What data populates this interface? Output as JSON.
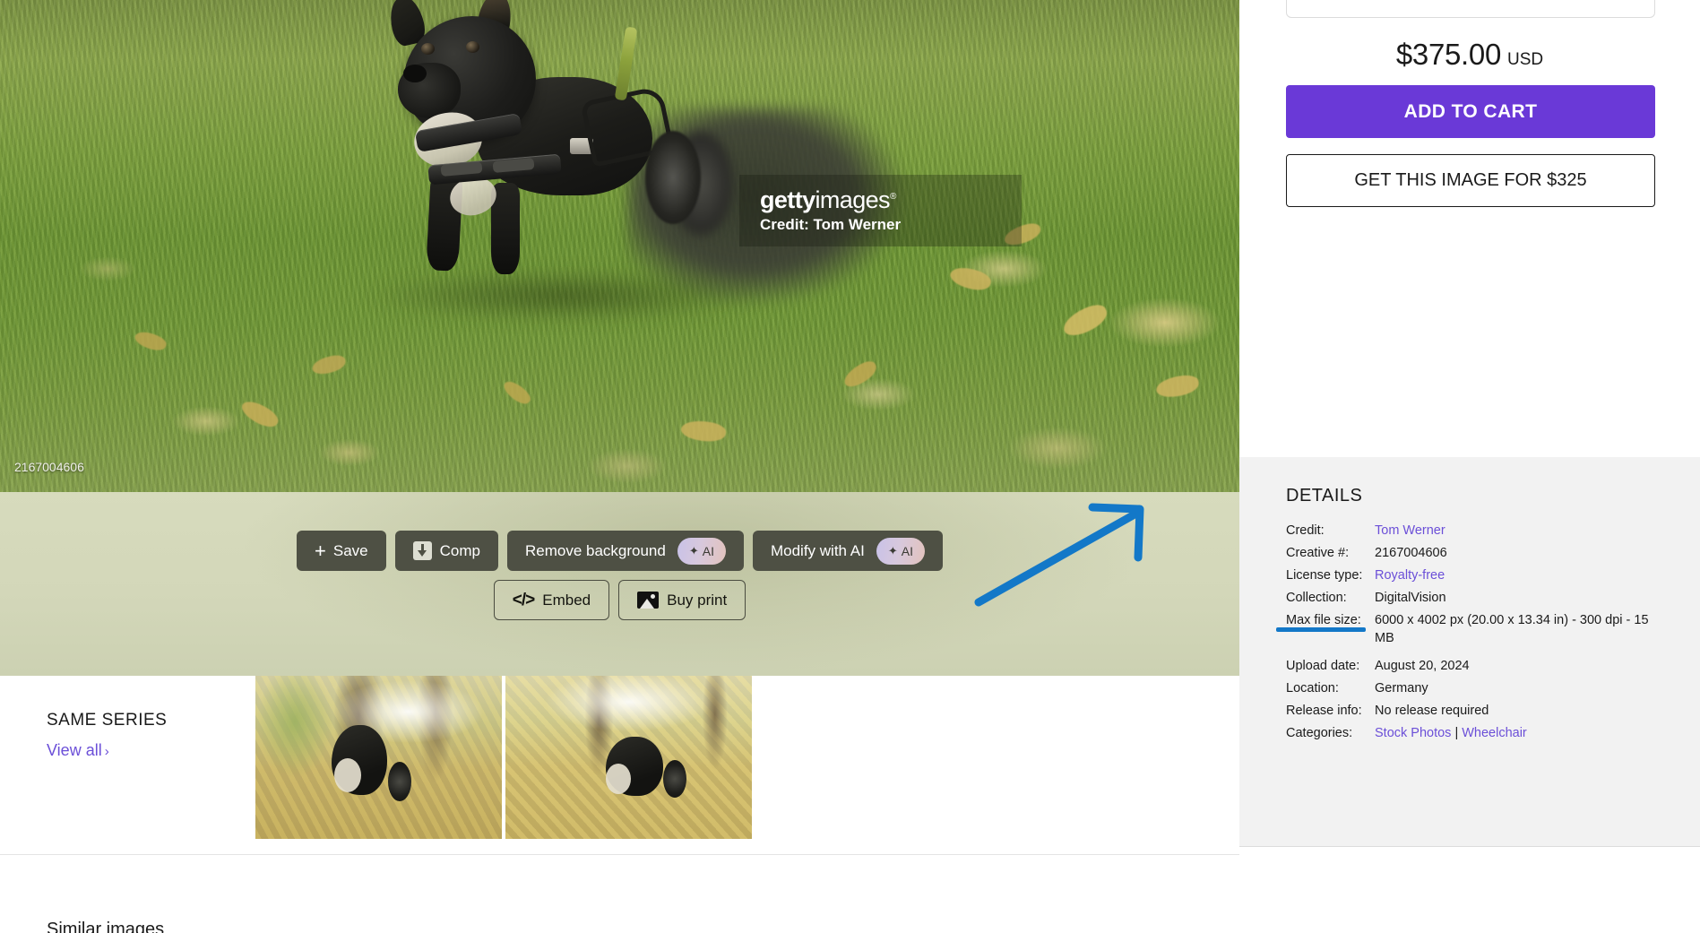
{
  "hero": {
    "watermark_logo_bold": "getty",
    "watermark_logo_light": "images",
    "watermark_registered": "®",
    "watermark_credit": "Credit: Tom Werner",
    "asset_id": "2167004606"
  },
  "actions": {
    "save_label": "Save",
    "comp_label": "Comp",
    "remove_background_label": "Remove background",
    "remove_background_badge": "AI",
    "modify_with_ai_label": "Modify with AI",
    "modify_with_ai_badge": "AI",
    "embed_label": "Embed",
    "buy_print_label": "Buy print",
    "spark_glyph": "✦"
  },
  "series": {
    "heading": "SAME SERIES",
    "view_all_label": "View all",
    "view_all_chevron": "›"
  },
  "bottom": {
    "heading": "Similar images"
  },
  "purchase": {
    "price": "$375.00",
    "currency": "USD",
    "add_to_cart_label": "ADD TO CART",
    "get_image_label": "GET THIS IMAGE FOR $325"
  },
  "details": {
    "heading": "DETAILS",
    "rows": [
      {
        "key": "Credit:",
        "value": "Tom Werner",
        "link": true
      },
      {
        "key": "Creative #:",
        "value": "2167004606",
        "link": false
      },
      {
        "key": "License type:",
        "value": "Royalty-free",
        "link": true
      },
      {
        "key": "Collection:",
        "value": "DigitalVision",
        "link": false
      },
      {
        "key": "Max file size:",
        "value": "6000 x 4002 px (20.00 x 13.34 in) - 300 dpi - 15 MB",
        "link": false
      },
      {
        "key": "Upload date:",
        "value": "August 20, 2024",
        "link": false
      },
      {
        "key": "Location:",
        "value": "Germany",
        "link": false
      },
      {
        "key": "Release info:",
        "value": "No release required",
        "link": false
      }
    ],
    "categories_key": "Categories:",
    "categories": [
      "Stock Photos",
      "Wheelchair"
    ],
    "categories_separator": "|"
  },
  "annotation": {
    "color": "#1378c8",
    "target": "License type:"
  },
  "colors": {
    "brand_purple": "#6a39d7",
    "link_purple": "#6b4fd8",
    "band_olive": "#d7dbbd",
    "button_dark": "#4e5044",
    "details_bg": "#f2f2f2",
    "annotation_blue": "#1378c8"
  }
}
